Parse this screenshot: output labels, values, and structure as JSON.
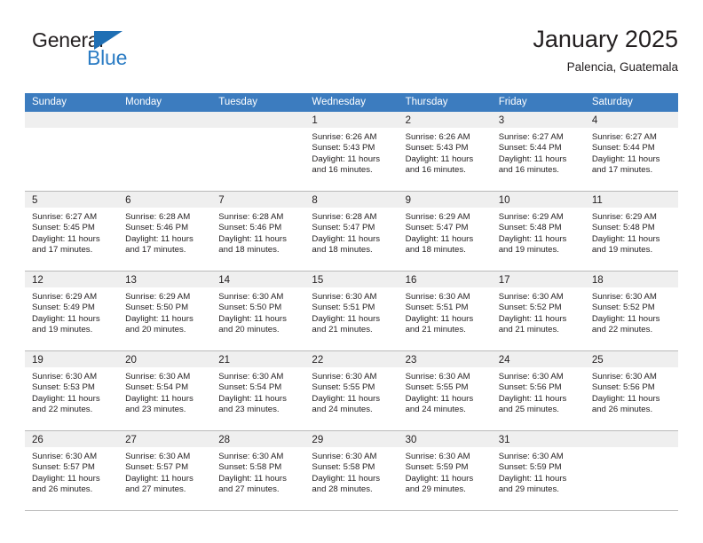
{
  "brand": {
    "name_part1": "General",
    "name_part2": "Blue",
    "triangle_color": "#1f6fb4",
    "blue_text_color": "#2b7cc4"
  },
  "header": {
    "title": "January 2025",
    "subtitle": "Palencia, Guatemala"
  },
  "theme": {
    "header_row_bg": "#3c7cbf",
    "header_row_text": "#ffffff",
    "day_band_bg": "#efefef",
    "cell_border": "#b9b9b9",
    "text_color": "#231f20"
  },
  "weekdays": [
    "Sunday",
    "Monday",
    "Tuesday",
    "Wednesday",
    "Thursday",
    "Friday",
    "Saturday"
  ],
  "weeks": [
    [
      {
        "day": "",
        "empty": true,
        "sunrise": "",
        "sunset": "",
        "daylight_line1": "",
        "daylight_line2": ""
      },
      {
        "day": "",
        "empty": true,
        "sunrise": "",
        "sunset": "",
        "daylight_line1": "",
        "daylight_line2": ""
      },
      {
        "day": "",
        "empty": true,
        "sunrise": "",
        "sunset": "",
        "daylight_line1": "",
        "daylight_line2": ""
      },
      {
        "day": "1",
        "empty": false,
        "sunrise": "Sunrise: 6:26 AM",
        "sunset": "Sunset: 5:43 PM",
        "daylight_line1": "Daylight: 11 hours",
        "daylight_line2": "and 16 minutes."
      },
      {
        "day": "2",
        "empty": false,
        "sunrise": "Sunrise: 6:26 AM",
        "sunset": "Sunset: 5:43 PM",
        "daylight_line1": "Daylight: 11 hours",
        "daylight_line2": "and 16 minutes."
      },
      {
        "day": "3",
        "empty": false,
        "sunrise": "Sunrise: 6:27 AM",
        "sunset": "Sunset: 5:44 PM",
        "daylight_line1": "Daylight: 11 hours",
        "daylight_line2": "and 16 minutes."
      },
      {
        "day": "4",
        "empty": false,
        "sunrise": "Sunrise: 6:27 AM",
        "sunset": "Sunset: 5:44 PM",
        "daylight_line1": "Daylight: 11 hours",
        "daylight_line2": "and 17 minutes."
      }
    ],
    [
      {
        "day": "5",
        "empty": false,
        "sunrise": "Sunrise: 6:27 AM",
        "sunset": "Sunset: 5:45 PM",
        "daylight_line1": "Daylight: 11 hours",
        "daylight_line2": "and 17 minutes."
      },
      {
        "day": "6",
        "empty": false,
        "sunrise": "Sunrise: 6:28 AM",
        "sunset": "Sunset: 5:46 PM",
        "daylight_line1": "Daylight: 11 hours",
        "daylight_line2": "and 17 minutes."
      },
      {
        "day": "7",
        "empty": false,
        "sunrise": "Sunrise: 6:28 AM",
        "sunset": "Sunset: 5:46 PM",
        "daylight_line1": "Daylight: 11 hours",
        "daylight_line2": "and 18 minutes."
      },
      {
        "day": "8",
        "empty": false,
        "sunrise": "Sunrise: 6:28 AM",
        "sunset": "Sunset: 5:47 PM",
        "daylight_line1": "Daylight: 11 hours",
        "daylight_line2": "and 18 minutes."
      },
      {
        "day": "9",
        "empty": false,
        "sunrise": "Sunrise: 6:29 AM",
        "sunset": "Sunset: 5:47 PM",
        "daylight_line1": "Daylight: 11 hours",
        "daylight_line2": "and 18 minutes."
      },
      {
        "day": "10",
        "empty": false,
        "sunrise": "Sunrise: 6:29 AM",
        "sunset": "Sunset: 5:48 PM",
        "daylight_line1": "Daylight: 11 hours",
        "daylight_line2": "and 19 minutes."
      },
      {
        "day": "11",
        "empty": false,
        "sunrise": "Sunrise: 6:29 AM",
        "sunset": "Sunset: 5:48 PM",
        "daylight_line1": "Daylight: 11 hours",
        "daylight_line2": "and 19 minutes."
      }
    ],
    [
      {
        "day": "12",
        "empty": false,
        "sunrise": "Sunrise: 6:29 AM",
        "sunset": "Sunset: 5:49 PM",
        "daylight_line1": "Daylight: 11 hours",
        "daylight_line2": "and 19 minutes."
      },
      {
        "day": "13",
        "empty": false,
        "sunrise": "Sunrise: 6:29 AM",
        "sunset": "Sunset: 5:50 PM",
        "daylight_line1": "Daylight: 11 hours",
        "daylight_line2": "and 20 minutes."
      },
      {
        "day": "14",
        "empty": false,
        "sunrise": "Sunrise: 6:30 AM",
        "sunset": "Sunset: 5:50 PM",
        "daylight_line1": "Daylight: 11 hours",
        "daylight_line2": "and 20 minutes."
      },
      {
        "day": "15",
        "empty": false,
        "sunrise": "Sunrise: 6:30 AM",
        "sunset": "Sunset: 5:51 PM",
        "daylight_line1": "Daylight: 11 hours",
        "daylight_line2": "and 21 minutes."
      },
      {
        "day": "16",
        "empty": false,
        "sunrise": "Sunrise: 6:30 AM",
        "sunset": "Sunset: 5:51 PM",
        "daylight_line1": "Daylight: 11 hours",
        "daylight_line2": "and 21 minutes."
      },
      {
        "day": "17",
        "empty": false,
        "sunrise": "Sunrise: 6:30 AM",
        "sunset": "Sunset: 5:52 PM",
        "daylight_line1": "Daylight: 11 hours",
        "daylight_line2": "and 21 minutes."
      },
      {
        "day": "18",
        "empty": false,
        "sunrise": "Sunrise: 6:30 AM",
        "sunset": "Sunset: 5:52 PM",
        "daylight_line1": "Daylight: 11 hours",
        "daylight_line2": "and 22 minutes."
      }
    ],
    [
      {
        "day": "19",
        "empty": false,
        "sunrise": "Sunrise: 6:30 AM",
        "sunset": "Sunset: 5:53 PM",
        "daylight_line1": "Daylight: 11 hours",
        "daylight_line2": "and 22 minutes."
      },
      {
        "day": "20",
        "empty": false,
        "sunrise": "Sunrise: 6:30 AM",
        "sunset": "Sunset: 5:54 PM",
        "daylight_line1": "Daylight: 11 hours",
        "daylight_line2": "and 23 minutes."
      },
      {
        "day": "21",
        "empty": false,
        "sunrise": "Sunrise: 6:30 AM",
        "sunset": "Sunset: 5:54 PM",
        "daylight_line1": "Daylight: 11 hours",
        "daylight_line2": "and 23 minutes."
      },
      {
        "day": "22",
        "empty": false,
        "sunrise": "Sunrise: 6:30 AM",
        "sunset": "Sunset: 5:55 PM",
        "daylight_line1": "Daylight: 11 hours",
        "daylight_line2": "and 24 minutes."
      },
      {
        "day": "23",
        "empty": false,
        "sunrise": "Sunrise: 6:30 AM",
        "sunset": "Sunset: 5:55 PM",
        "daylight_line1": "Daylight: 11 hours",
        "daylight_line2": "and 24 minutes."
      },
      {
        "day": "24",
        "empty": false,
        "sunrise": "Sunrise: 6:30 AM",
        "sunset": "Sunset: 5:56 PM",
        "daylight_line1": "Daylight: 11 hours",
        "daylight_line2": "and 25 minutes."
      },
      {
        "day": "25",
        "empty": false,
        "sunrise": "Sunrise: 6:30 AM",
        "sunset": "Sunset: 5:56 PM",
        "daylight_line1": "Daylight: 11 hours",
        "daylight_line2": "and 26 minutes."
      }
    ],
    [
      {
        "day": "26",
        "empty": false,
        "sunrise": "Sunrise: 6:30 AM",
        "sunset": "Sunset: 5:57 PM",
        "daylight_line1": "Daylight: 11 hours",
        "daylight_line2": "and 26 minutes."
      },
      {
        "day": "27",
        "empty": false,
        "sunrise": "Sunrise: 6:30 AM",
        "sunset": "Sunset: 5:57 PM",
        "daylight_line1": "Daylight: 11 hours",
        "daylight_line2": "and 27 minutes."
      },
      {
        "day": "28",
        "empty": false,
        "sunrise": "Sunrise: 6:30 AM",
        "sunset": "Sunset: 5:58 PM",
        "daylight_line1": "Daylight: 11 hours",
        "daylight_line2": "and 27 minutes."
      },
      {
        "day": "29",
        "empty": false,
        "sunrise": "Sunrise: 6:30 AM",
        "sunset": "Sunset: 5:58 PM",
        "daylight_line1": "Daylight: 11 hours",
        "daylight_line2": "and 28 minutes."
      },
      {
        "day": "30",
        "empty": false,
        "sunrise": "Sunrise: 6:30 AM",
        "sunset": "Sunset: 5:59 PM",
        "daylight_line1": "Daylight: 11 hours",
        "daylight_line2": "and 29 minutes."
      },
      {
        "day": "31",
        "empty": false,
        "sunrise": "Sunrise: 6:30 AM",
        "sunset": "Sunset: 5:59 PM",
        "daylight_line1": "Daylight: 11 hours",
        "daylight_line2": "and 29 minutes."
      },
      {
        "day": "",
        "empty": true,
        "sunrise": "",
        "sunset": "",
        "daylight_line1": "",
        "daylight_line2": ""
      }
    ]
  ]
}
